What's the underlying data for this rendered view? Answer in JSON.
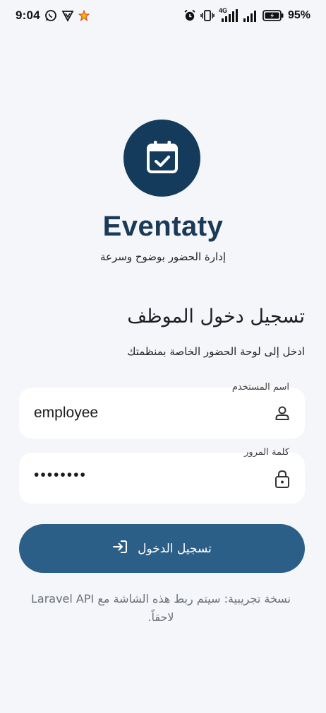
{
  "status_bar": {
    "time": "9:04",
    "battery": "95%",
    "network": "4G"
  },
  "app": {
    "name": "Eventaty",
    "tagline": "إدارة الحضور بوضوح وسرعة"
  },
  "form": {
    "title": "تسجيل دخول الموظف",
    "subtitle": "ادخل إلى لوحة الحضور الخاصة بمنظمتك",
    "username_label": "اسم المستخدم",
    "username_value": "employee",
    "password_label": "كلمة المرور",
    "password_value": "••••••••",
    "login_button": "تسجيل الدخول"
  },
  "note": "نسخة تجريبية: سيتم ربط هذه الشاشة مع Laravel API لاحقاً.",
  "colors": {
    "primary_dark": "#153b5c",
    "button": "#2c5f88",
    "background": "#f4f6f9"
  },
  "icons": {
    "logo": "calendar-check-icon",
    "username": "person-icon",
    "password": "lock-icon",
    "login": "login-arrow-icon"
  }
}
